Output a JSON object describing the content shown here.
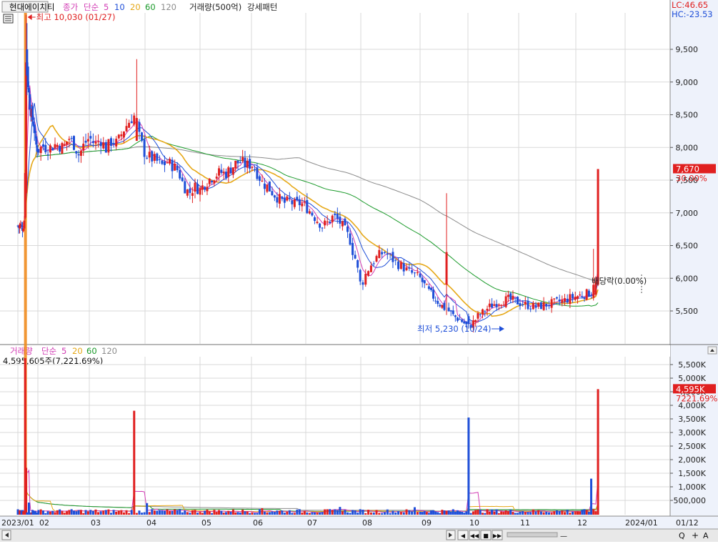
{
  "title": {
    "stock_name": "현대에이치티",
    "price_label_prefix": "종가",
    "ma_type": "단순",
    "ma_periods": [
      "5",
      "10",
      "20",
      "60",
      "120"
    ],
    "overlay": "거래량(500억)",
    "pattern": "강세패턴"
  },
  "corner": {
    "lc": "LC:46.65",
    "hc": "HC:-23.53"
  },
  "volume_header": {
    "label": "거래량",
    "ma_type": "단순",
    "ma_periods": [
      "5",
      "20",
      "60",
      "120"
    ],
    "info": "4,595,605주(7,221.69%)"
  },
  "annotations": {
    "high": "최고 10,030 (01/27)",
    "low": "최저 5,230 (10/24)",
    "dividend": "배당락(0.00%)"
  },
  "price_tag": {
    "value": "7,670",
    "pct": "30.00%"
  },
  "volume_tag": {
    "value": "4,595K",
    "pct": "7221.69%"
  },
  "colors": {
    "up": "#e02020",
    "down": "#1f4fd8",
    "ma5": "#d23cb4",
    "ma10": "#1f4fd8",
    "ma20": "#e6a817",
    "ma60": "#1a9a2a",
    "ma120": "#8c8c8c",
    "highlight": "#f08c1e"
  },
  "controls": {
    "buttons": [
      "◀",
      "◀◀",
      "■",
      "▶▶"
    ],
    "zoom": [
      "Q",
      "+",
      "A"
    ]
  },
  "chart_data": {
    "type": "candlestick",
    "price_ticks": [
      "9,500",
      "9,000",
      "8,500",
      "8,000",
      "7,500",
      "7,000",
      "6,500",
      "6,000",
      "5,500"
    ],
    "volume_ticks": [
      "5,500K",
      "5,000K",
      "4,500K",
      "4,000K",
      "3,500K",
      "3,000K",
      "2,500K",
      "2,000K",
      "1,500K",
      "1,000K",
      "500,000"
    ],
    "x_ticks": [
      "2023/01",
      "02",
      "03",
      "04",
      "05",
      "06",
      "07",
      "08",
      "09",
      "10",
      "11",
      "12",
      "2024/01",
      "01/12"
    ],
    "price_range": [
      5000,
      10030
    ],
    "volume_range": [
      0,
      5800000
    ],
    "anchors": {
      "x_month_index": [
        0,
        1,
        2,
        3,
        4,
        5,
        6,
        7,
        8,
        9,
        10,
        11,
        12,
        12.45
      ],
      "price_path": [
        [
          0,
          6800
        ],
        [
          0.05,
          6780
        ],
        [
          0.12,
          6820
        ],
        [
          0.2,
          6760
        ],
        [
          0.26,
          6800
        ],
        [
          0.32,
          6880
        ],
        [
          0.36,
          7200
        ],
        [
          0.38,
          8400
        ],
        [
          0.4,
          9800
        ],
        [
          0.43,
          9400
        ],
        [
          0.5,
          9000
        ],
        [
          0.6,
          8650
        ],
        [
          0.7,
          8480
        ],
        [
          0.8,
          8350
        ],
        [
          0.9,
          8050
        ],
        [
          1.0,
          7960
        ],
        [
          1.1,
          8020
        ],
        [
          1.2,
          7980
        ],
        [
          1.35,
          8050
        ],
        [
          1.5,
          8000
        ],
        [
          1.6,
          8150
        ],
        [
          1.7,
          8050
        ],
        [
          1.8,
          7880
        ],
        [
          1.9,
          8050
        ],
        [
          2.0,
          8150
        ],
        [
          2.1,
          8050
        ],
        [
          2.2,
          8120
        ],
        [
          2.3,
          7980
        ],
        [
          2.4,
          8100
        ],
        [
          2.5,
          8060
        ],
        [
          2.6,
          8250
        ],
        [
          2.7,
          8380
        ],
        [
          2.8,
          8500
        ],
        [
          2.85,
          8300
        ],
        [
          2.9,
          8150
        ],
        [
          3.0,
          7900
        ],
        [
          3.1,
          7840
        ],
        [
          3.2,
          7800
        ],
        [
          3.3,
          7720
        ],
        [
          3.4,
          7780
        ],
        [
          3.5,
          7720
        ],
        [
          3.6,
          7650
        ],
        [
          3.7,
          7420
        ],
        [
          3.8,
          7300
        ],
        [
          3.9,
          7400
        ],
        [
          4.0,
          7360
        ],
        [
          4.1,
          7450
        ],
        [
          4.2,
          7530
        ],
        [
          4.3,
          7580
        ],
        [
          4.4,
          7620
        ],
        [
          4.5,
          7600
        ],
        [
          4.6,
          7680
        ],
        [
          4.7,
          7760
        ],
        [
          4.8,
          7780
        ],
        [
          4.9,
          7720
        ],
        [
          5.0,
          7750
        ],
        [
          5.1,
          7620
        ],
        [
          5.2,
          7460
        ],
        [
          5.3,
          7400
        ],
        [
          5.4,
          7300
        ],
        [
          5.5,
          7220
        ],
        [
          5.6,
          7150
        ],
        [
          5.7,
          7180
        ],
        [
          5.8,
          7120
        ],
        [
          5.9,
          7150
        ],
        [
          6.0,
          7100
        ],
        [
          6.1,
          7000
        ],
        [
          6.2,
          6900
        ],
        [
          6.3,
          6800
        ],
        [
          6.4,
          6850
        ],
        [
          6.5,
          6950
        ],
        [
          6.6,
          6880
        ],
        [
          6.7,
          6750
        ],
        [
          6.8,
          6600
        ],
        [
          6.85,
          6420
        ],
        [
          6.9,
          6300
        ],
        [
          6.95,
          6100
        ],
        [
          7.0,
          5880
        ],
        [
          7.1,
          6100
        ],
        [
          7.2,
          6250
        ],
        [
          7.3,
          6350
        ],
        [
          7.4,
          6400
        ],
        [
          7.5,
          6320
        ],
        [
          7.6,
          6230
        ],
        [
          7.7,
          6180
        ],
        [
          7.8,
          6100
        ],
        [
          7.9,
          6060
        ],
        [
          8.0,
          6000
        ],
        [
          8.1,
          5880
        ],
        [
          8.2,
          5780
        ],
        [
          8.3,
          5700
        ],
        [
          8.4,
          5620
        ],
        [
          8.5,
          5550
        ],
        [
          8.6,
          5500
        ],
        [
          8.7,
          5420
        ],
        [
          8.8,
          5380
        ],
        [
          8.9,
          5330
        ],
        [
          9.0,
          5250
        ],
        [
          9.1,
          5320
        ],
        [
          9.2,
          5420
        ],
        [
          9.3,
          5480
        ],
        [
          9.4,
          5550
        ],
        [
          9.5,
          5600
        ],
        [
          9.6,
          5640
        ],
        [
          9.7,
          5660
        ],
        [
          9.8,
          5680
        ],
        [
          9.9,
          5660
        ],
        [
          10.0,
          5630
        ],
        [
          10.1,
          5600
        ],
        [
          10.2,
          5580
        ],
        [
          10.3,
          5560
        ],
        [
          10.4,
          5580
        ],
        [
          10.5,
          5600
        ],
        [
          10.6,
          5620
        ],
        [
          10.7,
          5640
        ],
        [
          10.8,
          5660
        ],
        [
          10.9,
          5700
        ],
        [
          11.0,
          5720
        ],
        [
          11.1,
          5740
        ],
        [
          11.2,
          5760
        ],
        [
          11.3,
          5780
        ],
        [
          11.4,
          5760
        ],
        [
          11.45,
          7670
        ]
      ],
      "volume_spikes": [
        [
          0.38,
          5800000
        ],
        [
          0.42,
          1700000
        ],
        [
          0.55,
          420000
        ],
        [
          2.82,
          3800000
        ],
        [
          3.05,
          400000
        ],
        [
          5.2,
          210000
        ],
        [
          6.6,
          260000
        ],
        [
          7.9,
          250000
        ],
        [
          9.0,
          3550000
        ],
        [
          11.3,
          1300000
        ],
        [
          11.45,
          4595605
        ]
      ]
    }
  }
}
